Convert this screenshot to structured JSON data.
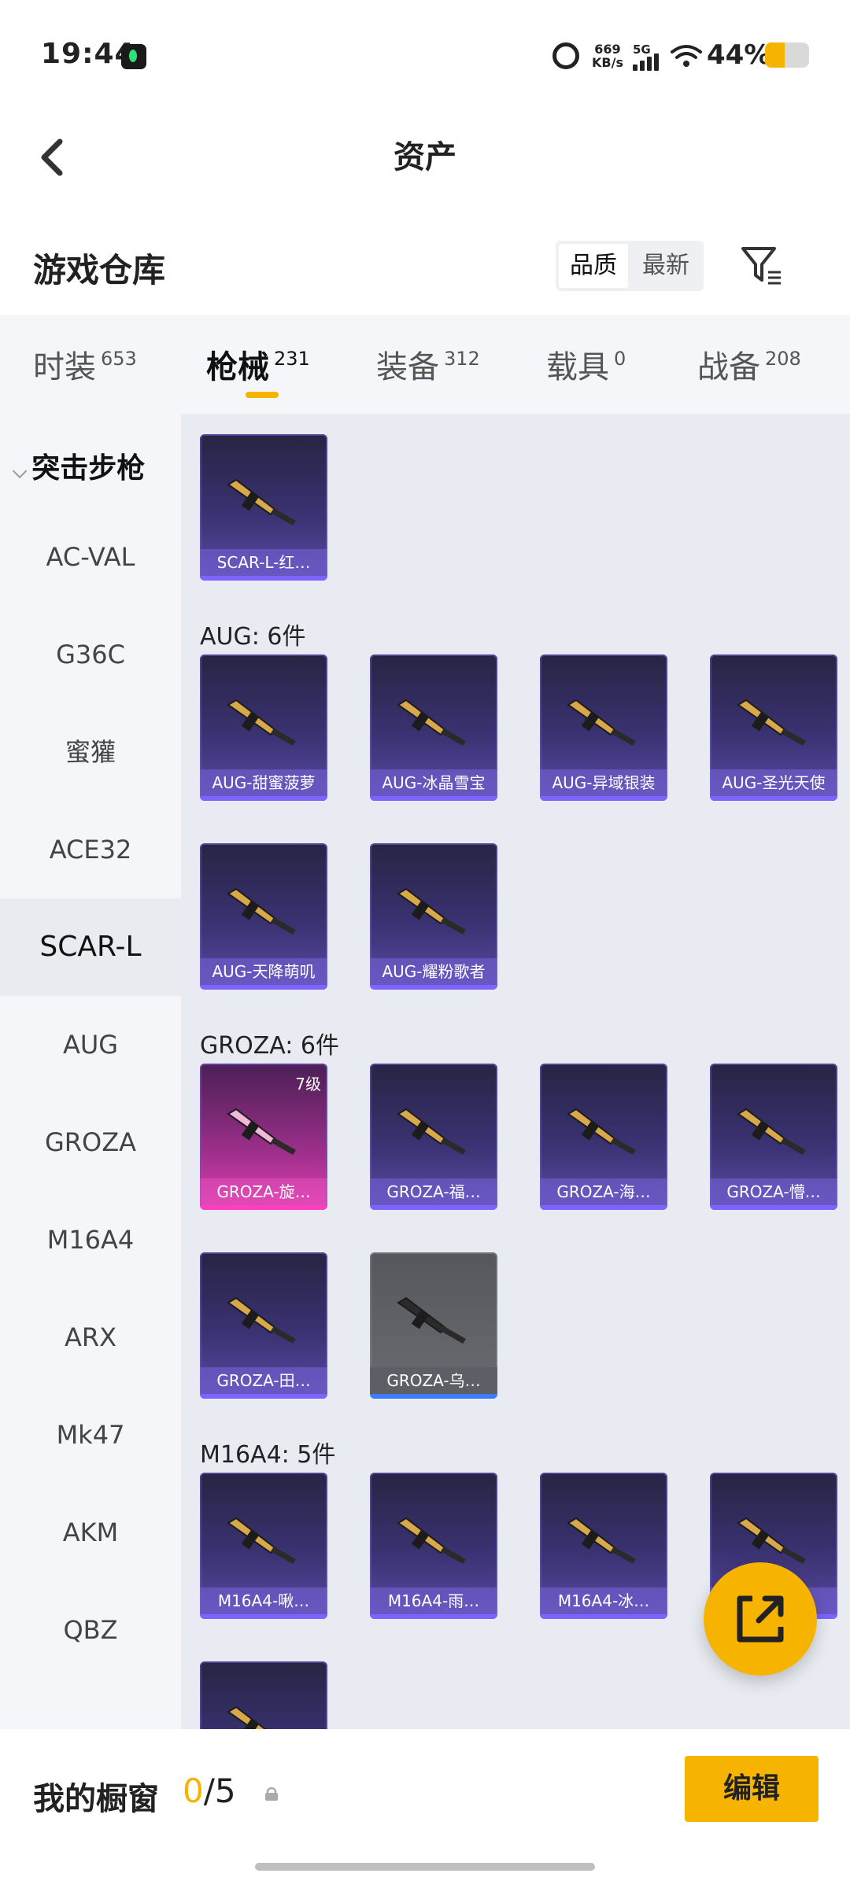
{
  "status_bar": {
    "time": "19:44",
    "net_speed_value": "669",
    "net_speed_unit": "KB/s",
    "network": "5G",
    "battery": "44%",
    "battery_level": 0.44
  },
  "header": {
    "title": "资产",
    "back_icon": "chevron-left-icon"
  },
  "warehouse": {
    "title": "游戏仓库",
    "sort_options": [
      "品质",
      "最新"
    ],
    "selected_sort": "品质",
    "filter_icon": "filter-icon"
  },
  "tabs": [
    {
      "label": "时装",
      "count": "653"
    },
    {
      "label": "枪械",
      "count": "231",
      "active": true
    },
    {
      "label": "装备",
      "count": "312"
    },
    {
      "label": "载具",
      "count": "0"
    },
    {
      "label": "战备",
      "count": "208"
    }
  ],
  "sidebar": {
    "category": "突击步枪",
    "items": [
      "AC-VAL",
      "G36C",
      "蜜獾",
      "ACE32",
      "SCAR-L",
      "AUG",
      "GROZA",
      "M16A4",
      "ARX",
      "Mk47",
      "AKM",
      "QBZ"
    ],
    "selected": "SCAR-L"
  },
  "groups": [
    {
      "label": "",
      "items": [
        {
          "name": "SCAR-L-红…",
          "style": "purple"
        }
      ]
    },
    {
      "label": "AUG: 6件",
      "items": [
        {
          "name": "AUG-甜蜜菠萝",
          "style": "purple"
        },
        {
          "name": "AUG-冰晶雪宝",
          "style": "purple"
        },
        {
          "name": "AUG-异域银装",
          "style": "purple"
        },
        {
          "name": "AUG-圣光天使",
          "style": "purple"
        },
        {
          "name": "AUG-天降萌叽",
          "style": "purple"
        },
        {
          "name": "AUG-耀粉歌者",
          "style": "purple"
        }
      ]
    },
    {
      "label": "GROZA: 6件",
      "items": [
        {
          "name": "GROZA-旋…",
          "style": "pink",
          "level": "7级"
        },
        {
          "name": "GROZA-福…",
          "style": "purple"
        },
        {
          "name": "GROZA-海…",
          "style": "purple"
        },
        {
          "name": "GROZA-懵…",
          "style": "purple"
        },
        {
          "name": "GROZA-田…",
          "style": "purple"
        },
        {
          "name": "GROZA-乌…",
          "style": "grey"
        }
      ]
    },
    {
      "label": "M16A4: 5件",
      "items": [
        {
          "name": "M16A4-啾…",
          "style": "purple"
        },
        {
          "name": "M16A4-雨…",
          "style": "purple"
        },
        {
          "name": "M16A4-冰…",
          "style": "purple"
        },
        {
          "name": "",
          "style": "purple"
        },
        {
          "name": "",
          "style": "purple"
        }
      ]
    }
  ],
  "fab_icon": "share-external-icon",
  "showcase": {
    "label": "我的橱窗",
    "current": "0",
    "total": "/5",
    "edit_label": "编辑",
    "lock_icon": "lock-icon"
  },
  "colors": {
    "accent": "#f6b400",
    "card_purple": "#3a3272",
    "card_pink": "#e040b0",
    "card_grey": "#6a6c72"
  }
}
